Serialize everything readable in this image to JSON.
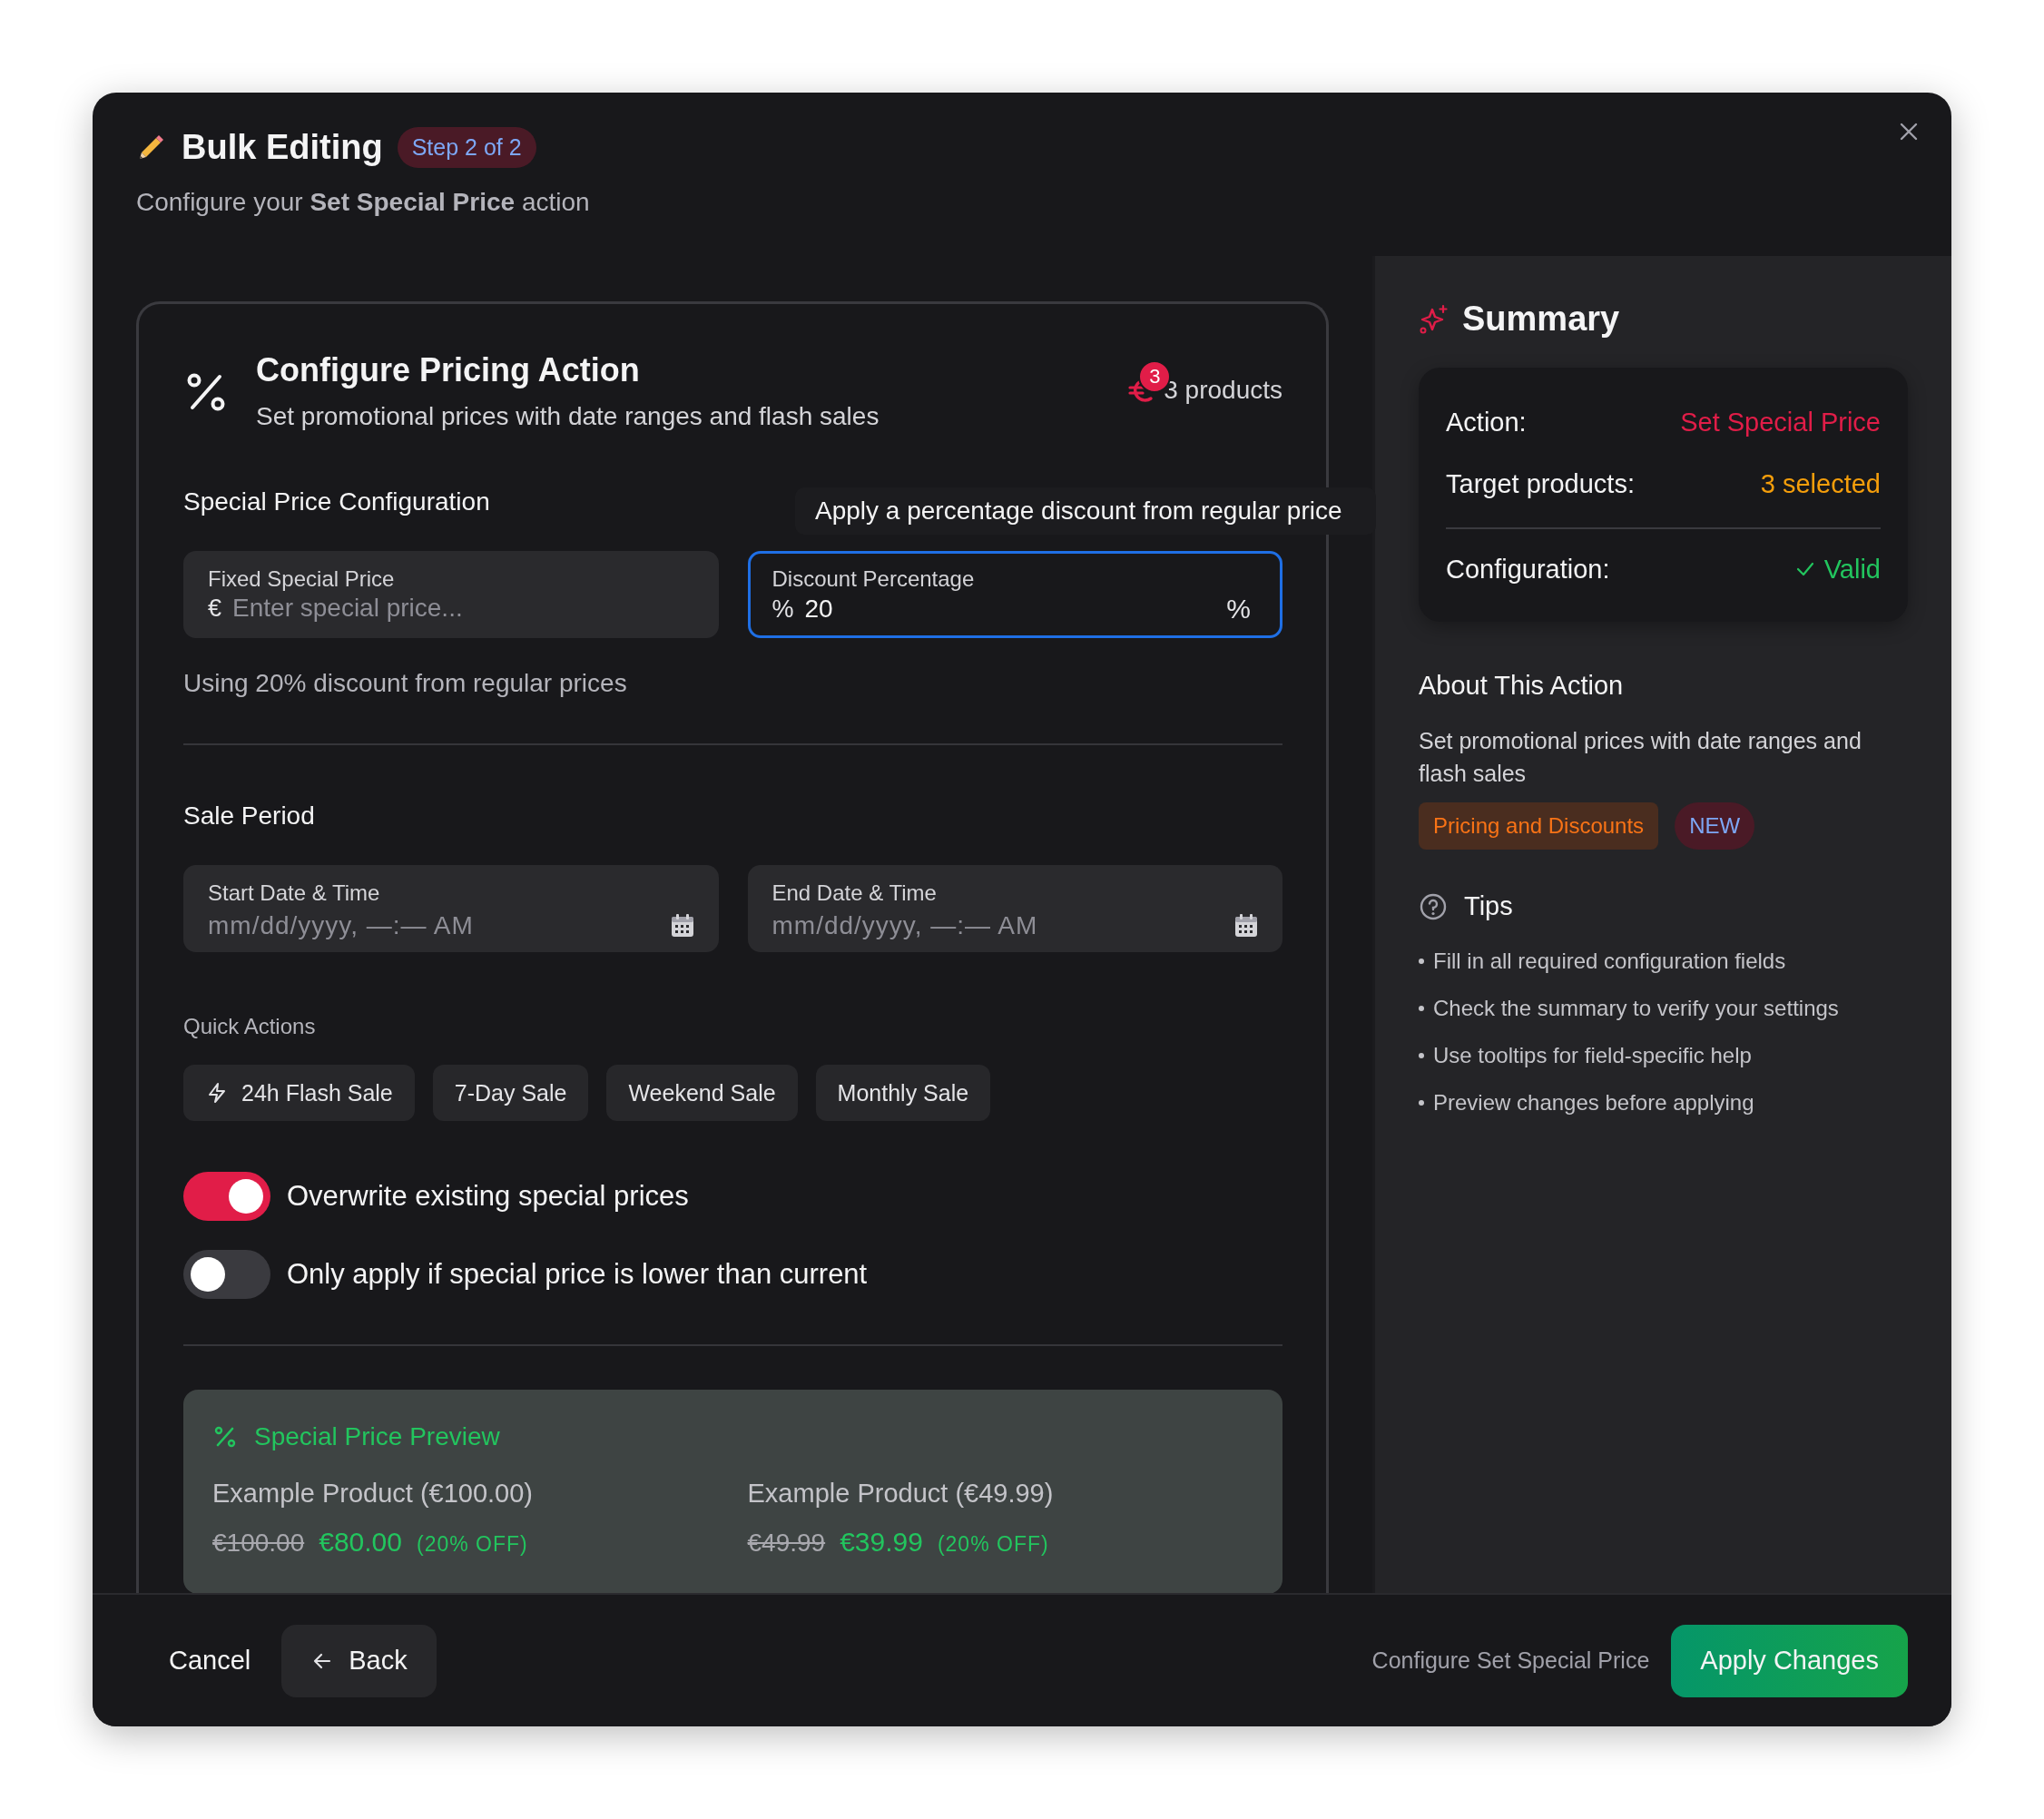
{
  "header": {
    "title": "Bulk Editing",
    "step_badge": "Step 2 of 2",
    "subtitle": "Configure your **Set Special Price** action"
  },
  "card": {
    "title": "Configure Pricing Action",
    "subtitle": "Set promotional prices with date ranges and flash sales",
    "product_badge": "3",
    "product_count": "3 products"
  },
  "price_config": {
    "heading": "Special Price Configuration",
    "fields": [
      {
        "label": "Fixed Special Price",
        "prefix": "€",
        "placeholder": "Enter special price...",
        "selected": false
      },
      {
        "label": "Discount Percentage",
        "prefix": "%",
        "value": "20",
        "suffix": "%",
        "selected": true
      }
    ],
    "hint": "Using 20% discount from regular prices",
    "tooltip": "Apply a percentage discount from regular price"
  },
  "sale_period": {
    "heading": "Sale Period",
    "fields": [
      {
        "label": "Start Date & Time",
        "placeholder": "mm/dd/yyyy, —:— AM"
      },
      {
        "label": "End Date & Time",
        "placeholder": "mm/dd/yyyy, —:— AM"
      }
    ]
  },
  "quick_actions": {
    "heading": "Quick Actions",
    "buttons": [
      {
        "label": "24h Flash Sale",
        "kind": "flash"
      },
      {
        "label": "7-Day Sale",
        "kind": "plain"
      },
      {
        "label": "Weekend Sale",
        "kind": "plain"
      },
      {
        "label": "Monthly Sale",
        "kind": "plain"
      }
    ]
  },
  "toggles": [
    {
      "label": "Overwrite existing special prices",
      "on": true
    },
    {
      "label": "Only apply if special price is lower than current",
      "on": false
    }
  ],
  "preview": {
    "title": "Special Price Preview",
    "items": [
      {
        "name": "Example Product (€100.00)",
        "old_price": "€100.00",
        "new_price": "€80.00",
        "discount": "(20% OFF)"
      },
      {
        "name": "Example Product (€49.99)",
        "old_price": "€49.99",
        "new_price": "€39.99",
        "discount": "(20% OFF)"
      }
    ]
  },
  "summary": {
    "title": "Summary",
    "rows": [
      {
        "label": "Action:",
        "value": "Set Special Price",
        "kind": "action"
      },
      {
        "label": "Target products:",
        "value": "3 selected",
        "kind": "count"
      },
      {
        "label": "Configuration:",
        "value": "Valid",
        "kind": "status"
      }
    ]
  },
  "about": {
    "heading": "About This Action",
    "text": "Set promotional prices with date ranges and flash sales",
    "tags": [
      {
        "label": "Pricing and Discounts",
        "kind": "category"
      },
      {
        "label": "NEW",
        "kind": "new"
      }
    ]
  },
  "tips": {
    "heading": "Tips",
    "items": [
      "Fill in all required configuration fields",
      "Check the summary to verify your settings",
      "Use tooltips for field-specific help",
      "Preview changes before applying"
    ]
  },
  "footer": {
    "cancel": "Cancel",
    "back": "Back",
    "status_text": "Configure Set Special Price",
    "apply": "Apply Changes"
  }
}
